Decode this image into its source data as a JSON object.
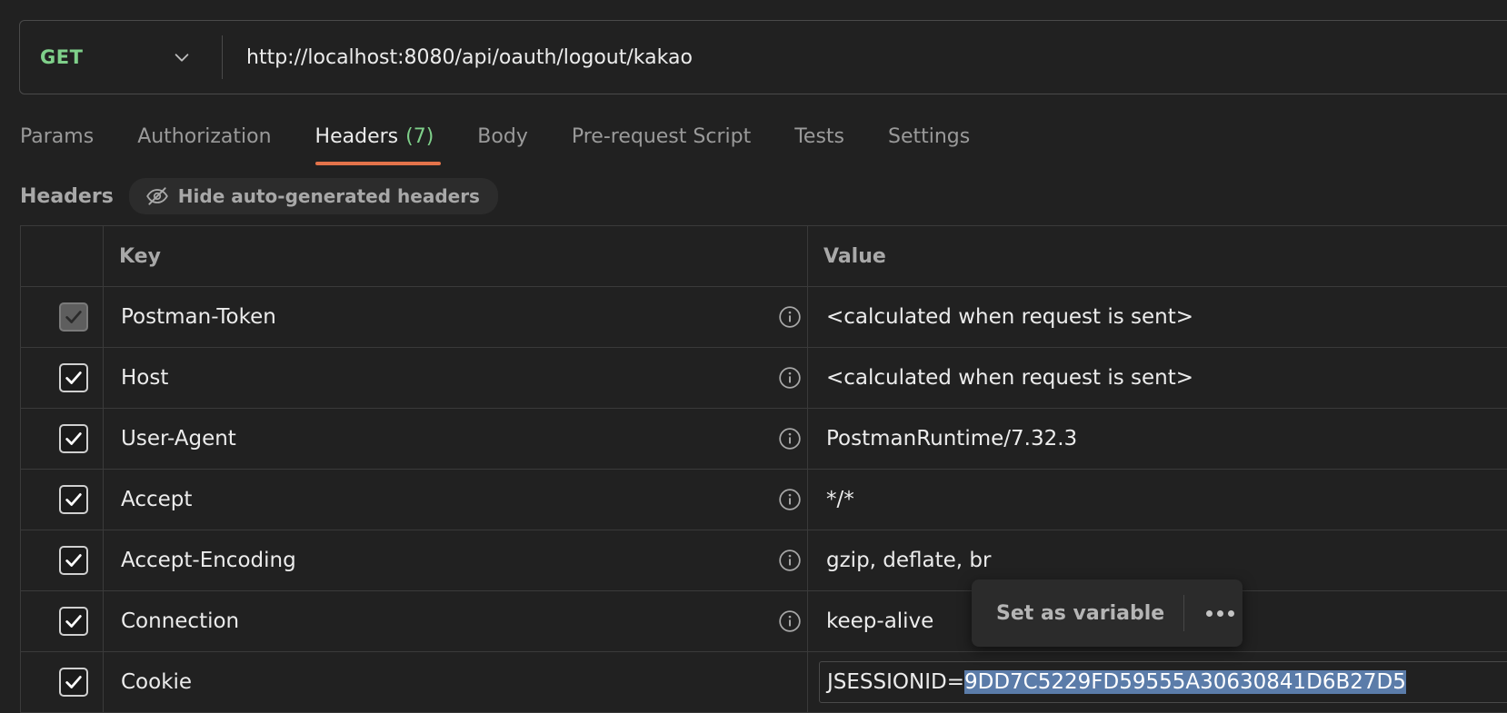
{
  "request": {
    "method": "GET",
    "url": "http://localhost:8080/api/oauth/logout/kakao"
  },
  "tabs": [
    {
      "label": "Params"
    },
    {
      "label": "Authorization"
    },
    {
      "label": "Headers",
      "count": "(7)"
    },
    {
      "label": "Body"
    },
    {
      "label": "Pre-request Script"
    },
    {
      "label": "Tests"
    },
    {
      "label": "Settings"
    }
  ],
  "headers_section": {
    "title": "Headers",
    "hide_button_label": "Hide auto-generated headers"
  },
  "table": {
    "columns": {
      "key": "Key",
      "value": "Value"
    },
    "rows": [
      {
        "key": "Postman-Token",
        "value": "<calculated when request is sent>"
      },
      {
        "key": "Host",
        "value": "<calculated when request is sent>"
      },
      {
        "key": "User-Agent",
        "value": "PostmanRuntime/7.32.3"
      },
      {
        "key": "Accept",
        "value": "*/*"
      },
      {
        "key": "Accept-Encoding",
        "value": "gzip, deflate, br"
      },
      {
        "key": "Connection",
        "value": "keep-alive"
      },
      {
        "key": "Cookie",
        "value_prefix": "JSESSIONID=",
        "value_selected": "9DD7C5229FD59555A30630841D6B27D5"
      }
    ]
  },
  "popover": {
    "set_variable_label": "Set as variable"
  },
  "colors": {
    "method": "#7fd08a",
    "active_tab_underline": "#e3734a",
    "count": "#7fd08a",
    "selection": "#5b7ca9"
  }
}
